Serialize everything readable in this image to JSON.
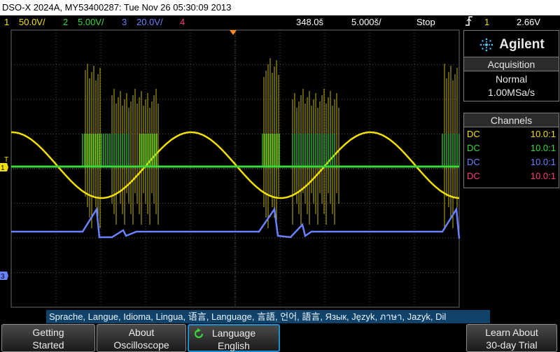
{
  "title_bar": "DSO-X 2024A, MY53400287: Tue Nov 26 05:30:09 2013",
  "status": {
    "ch1": "1",
    "ch1_scale": "50.0V/",
    "ch2": "2",
    "ch2_scale": "5.00V/",
    "ch3": "3",
    "ch3_scale": "20.0V/",
    "ch4": "4",
    "delay": "348.0š",
    "timebase": "5.000š/",
    "run_state": "Stop",
    "trigger_icon": "trigger-rising-edge-icon",
    "trigger_source": "1",
    "trigger_level": "2.66V"
  },
  "brand": "Agilent",
  "acquisition": {
    "header": "Acquisition",
    "mode": "Normal",
    "rate": "1.00MSa/s"
  },
  "channels": {
    "header": "Channels",
    "rows": [
      {
        "coupling": "DC",
        "ratio": "10.0:1",
        "color": "#f2e000"
      },
      {
        "coupling": "DC",
        "ratio": "10.0:1",
        "color": "#39d83c"
      },
      {
        "coupling": "DC",
        "ratio": "10.0:1",
        "color": "#6a82ff"
      },
      {
        "coupling": "DC",
        "ratio": "10.0:1",
        "color": "#ff3a80"
      }
    ]
  },
  "markers": {
    "trigger_level_marker": "T",
    "ch1_marker": "1",
    "ch3_marker": "3"
  },
  "language_bar": "Sprache, Langue, Idioma, Lingua, 语言, Language, 言語, 언어, 語言, Язык, Język, ภาษา, Jazyk, Dil",
  "softkeys": [
    {
      "line1": "Getting",
      "line2": "Started"
    },
    {
      "line1": "About",
      "line2": "Oscilloscope"
    },
    {
      "line1": "Language",
      "line2": "English"
    },
    {
      "line1": "Learn About",
      "line2": "30-day Trial"
    }
  ],
  "colors": {
    "ch1": "#f2e000",
    "ch2": "#39d83c",
    "ch3": "#6a82ff",
    "ch4": "#ff3a80",
    "trigger": "#ff8c1a",
    "menu_accent": "#1a8fd0"
  }
}
